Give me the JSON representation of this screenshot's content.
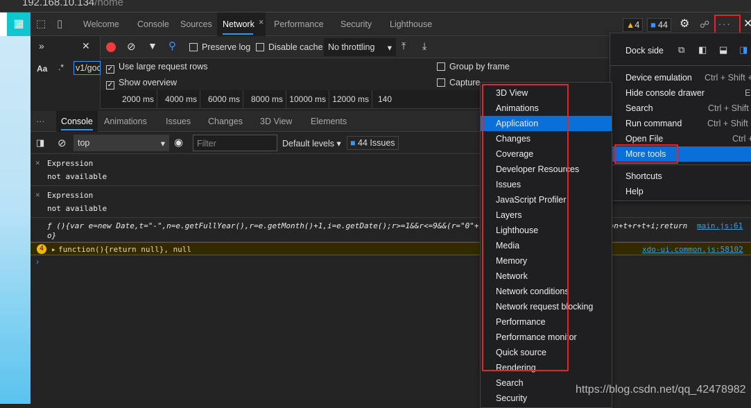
{
  "browser": {
    "url_host": "192.168.10.134",
    "url_path": "/home"
  },
  "devtools_tabs": [
    {
      "label": "Welcome"
    },
    {
      "label": "Console"
    },
    {
      "label": "Sources"
    },
    {
      "label": "Network",
      "active": true
    },
    {
      "label": "Performance"
    },
    {
      "label": "Security"
    },
    {
      "label": "Lighthouse"
    }
  ],
  "badges": {
    "warnings": "4",
    "issues": "44"
  },
  "network": {
    "search_value": "v1/goc",
    "case_label": "Aa",
    "regex_label": ".*",
    "preserve_log": "Preserve log",
    "disable_cache": "Disable cache",
    "throttling": "No throttling",
    "large_rows": "Use large request rows",
    "show_overview": "Show overview",
    "group_by_frame": "Group by frame",
    "capture": "Capture",
    "ticks": [
      "2000 ms",
      "4000 ms",
      "6000 ms",
      "8000 ms",
      "10000 ms",
      "12000 ms",
      "140"
    ]
  },
  "drawer_tabs": [
    "Console",
    "Animations",
    "Issues",
    "Changes",
    "3D View",
    "Elements"
  ],
  "console": {
    "context": "top",
    "filter_placeholder": "Filter",
    "levels": "Default levels",
    "issues": "44 Issues",
    "expressions": [
      {
        "label": "Expression",
        "value": "not available"
      },
      {
        "label": "Expression",
        "value": "not available"
      }
    ],
    "log_left": "ƒ (){var e=new Date,t=\"-\",n=e.getFullYear(),r=e.getMonth()+1,i=e.getDate();r>=1&&r<=9&&(r=\"0\"+r",
    "log_right": "o=n+t+r+t+i;return",
    "log_cont": "o}",
    "log_source": "main.js:61",
    "warn_count": "4",
    "warn_text": "function(){return null}, null",
    "warn_source": "xdo-ui.common.js:58102"
  },
  "main_menu": {
    "dock_side": "Dock side",
    "items": [
      {
        "label": "Device emulation",
        "shortcut": "Ctrl + Shift + M"
      },
      {
        "label": "Hide console drawer",
        "shortcut": "Esc"
      },
      {
        "label": "Search",
        "shortcut": "Ctrl + Shift + F"
      },
      {
        "label": "Run command",
        "shortcut": "Ctrl + Shift + P"
      },
      {
        "label": "Open File",
        "shortcut": "Ctrl + P"
      },
      {
        "label": "More tools",
        "shortcut": ""
      }
    ],
    "items2": [
      {
        "label": "Shortcuts"
      },
      {
        "label": "Help"
      }
    ]
  },
  "more_tools": [
    "3D View",
    "Animations",
    "Application",
    "Changes",
    "Coverage",
    "Developer Resources",
    "Issues",
    "JavaScript Profiler",
    "Layers",
    "Lighthouse",
    "Media",
    "Memory",
    "Network",
    "Network conditions",
    "Network request blocking",
    "Performance",
    "Performance monitor",
    "Quick source",
    "Rendering",
    "Search",
    "Security"
  ],
  "watermark": "https://blog.csdn.net/qq_42478982",
  "colors": {
    "accent": "#0a6fd8",
    "highlight_box": "#ee2222",
    "warning_row": "#332b00"
  }
}
